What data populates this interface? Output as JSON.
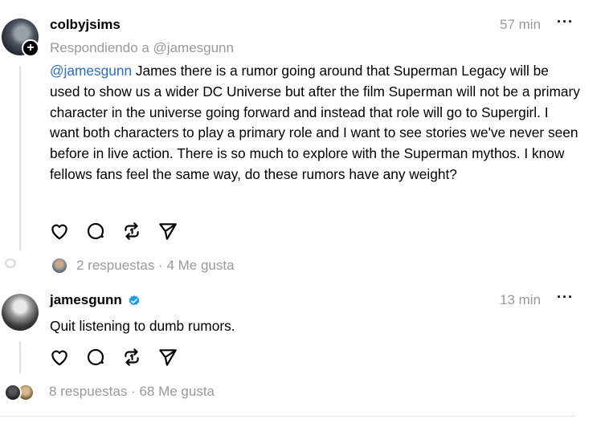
{
  "post1": {
    "username": "colbyjsims",
    "time": "57 min",
    "more": "···",
    "replying_to": "Respondiendo a @jamesgunn",
    "mention": "@jamesgunn",
    "text": " James there is a rumor going around that Superman Legacy will be used to show us a wider DC Universe but after the film Superman will not be a primary character in the universe going forward and instead that role will go to Supergirl. I want both characters to play a primary role and I want to see stories we've never seen before in live action. There is so much to explore with the Superman mythos. I know fellows fans feel the same way, do these rumors have any weight?",
    "stats": "2  respuestas  ·  4 Me gusta",
    "follow_badge": "+"
  },
  "post2": {
    "username": "jamesgunn",
    "verified": true,
    "time": "13 min",
    "more": "···",
    "text": "Quit listening to dumb rumors.",
    "stats": "8  respuestas  ·  68 Me gusta"
  },
  "icons": {
    "like": "heart-icon",
    "reply": "comment-icon",
    "repost": "repost-icon",
    "share": "send-icon"
  },
  "colors": {
    "mention": "#2b6cc4",
    "muted": "#999999",
    "verified": "#1d9bf0"
  }
}
